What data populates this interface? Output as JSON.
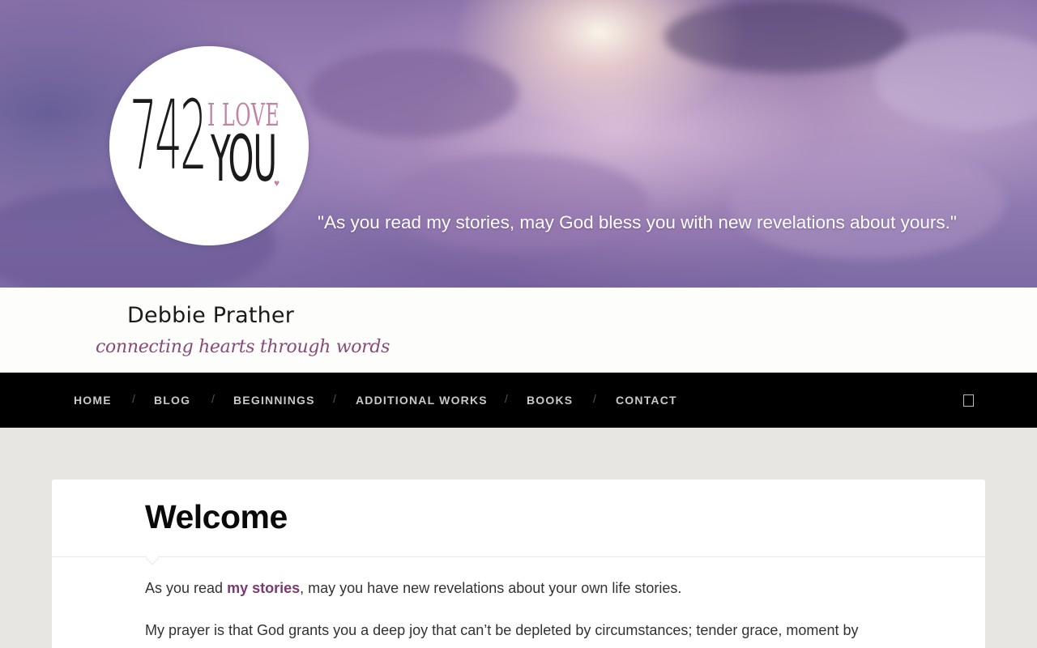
{
  "header": {
    "logo": {
      "number": "742",
      "top_line": "I LOVE",
      "bottom_line": "YOU",
      "heart": "♥"
    },
    "tagline": "\"As you read my stories, may God bless you with new revelations about yours.\""
  },
  "site": {
    "name": "Debbie Prather",
    "subtitle": "connecting hearts through words"
  },
  "nav": {
    "items": [
      {
        "label": "HOME"
      },
      {
        "label": "BLOG"
      },
      {
        "label": "BEGINNINGS"
      },
      {
        "label": "ADDITIONAL WORKS"
      },
      {
        "label": "BOOKS"
      },
      {
        "label": "CONTACT"
      }
    ],
    "separator": "/",
    "search_icon": "search-icon"
  },
  "content": {
    "title": "Welcome",
    "para1": {
      "before": "As you read ",
      "link": "my stories",
      "after": ", may you have new revelations about your own life stories."
    },
    "para2": "My prayer is that God grants you a deep joy that can’t be depleted by circumstances; tender grace, moment by"
  },
  "colors": {
    "nav_bg": "#000000",
    "link": "#7b3a6f",
    "accent_pink": "#c284a6",
    "page_bg": "#e8e6e2"
  }
}
